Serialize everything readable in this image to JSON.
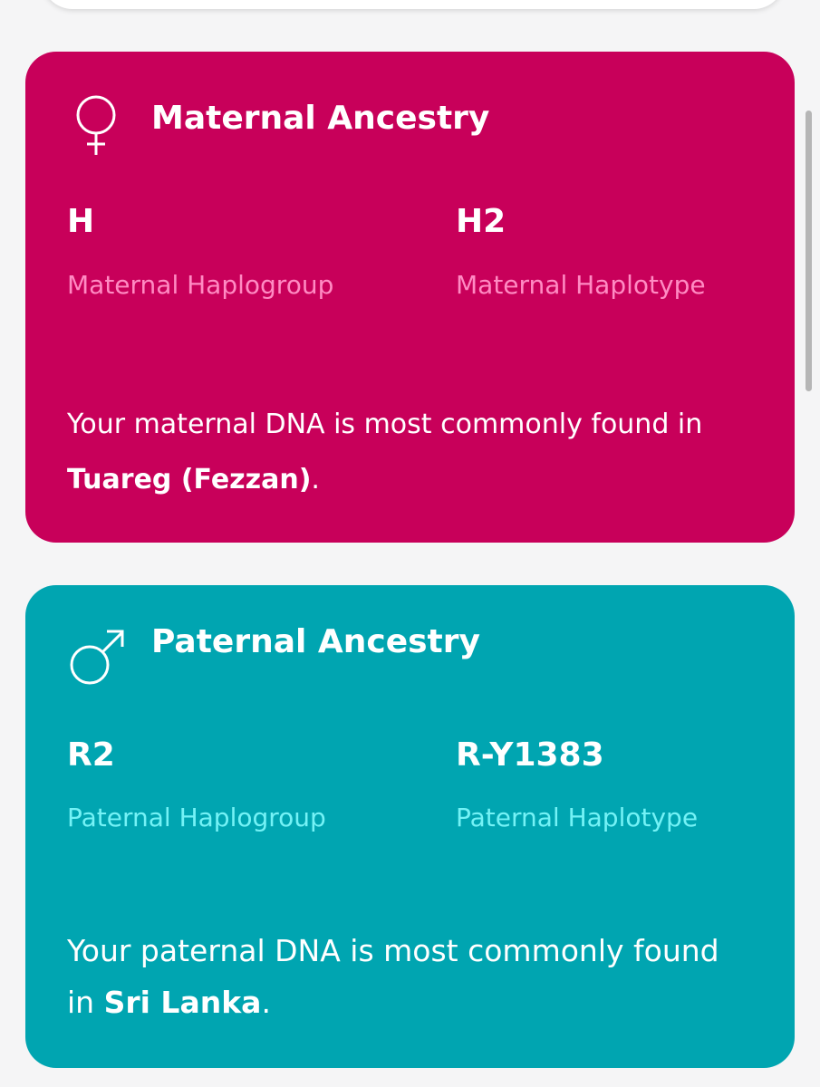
{
  "colors": {
    "background": "#f5f5f6",
    "maternal_card": "#c8005a",
    "maternal_label": "#ff8bc3",
    "paternal_card": "#00a5b1",
    "paternal_label": "#74f2f6",
    "text": "#ffffff"
  },
  "maternal": {
    "icon": "female-symbol-icon",
    "title": "Maternal Ancestry",
    "haplogroup_value": "H",
    "haplogroup_label": "Maternal Haplogroup",
    "haplotype_value": "H2",
    "haplotype_label": "Maternal Haplotype",
    "description_prefix": "Your maternal DNA is most commonly found in ",
    "description_place": "Tuareg (Fezzan)",
    "description_suffix": "."
  },
  "paternal": {
    "icon": "male-symbol-icon",
    "title": "Paternal Ancestry",
    "haplogroup_value": "R2",
    "haplogroup_label": "Paternal Haplogroup",
    "haplotype_value": "R-Y1383",
    "haplotype_label": "Paternal Haplotype",
    "description_prefix": "Your paternal DNA is most commonly found in ",
    "description_place": "Sri Lanka",
    "description_suffix": "."
  }
}
